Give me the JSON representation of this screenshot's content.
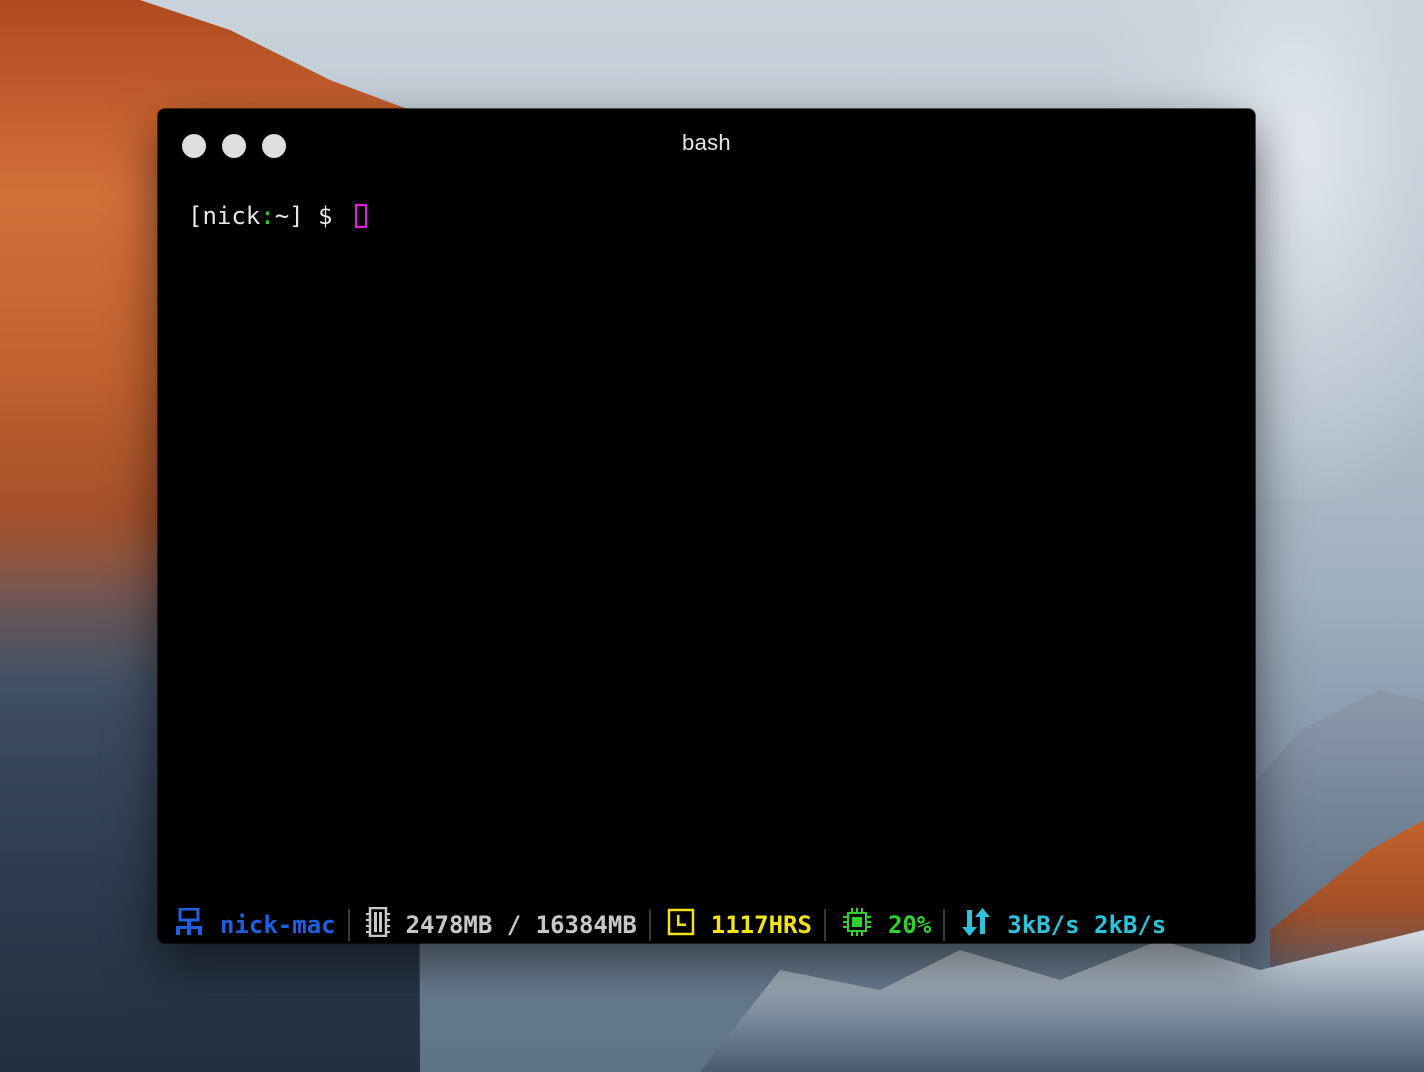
{
  "window": {
    "title": "bash"
  },
  "terminal": {
    "prompt_open": "[nick",
    "prompt_colon": ":",
    "prompt_close": "~] $ "
  },
  "statusbar": {
    "hostname": "nick-mac",
    "memory": "2478MB / 16384MB",
    "uptime": "1117HRS",
    "cpu": "20%",
    "network": "3kB/s 2kB/s",
    "icons": [
      "network-icon",
      "memory-icon",
      "clock-icon",
      "cpu-icon",
      "up-down-arrows-icon"
    ],
    "colors": {
      "hostname": "#1f5fe0",
      "memory": "#c8c8c8",
      "uptime": "#f2e21a",
      "cpu": "#2fd12f",
      "network": "#2ec3dc"
    }
  },
  "cursor_color": "#e01ee6"
}
